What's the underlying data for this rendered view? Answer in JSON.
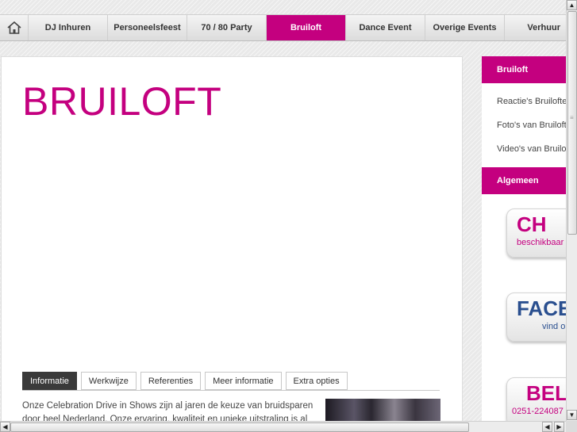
{
  "nav": {
    "home_icon": "home-icon",
    "items": [
      {
        "label": "DJ Inhuren",
        "active": false
      },
      {
        "label": "Personeelsfeest",
        "active": false
      },
      {
        "label": "70 / 80 Party",
        "active": false
      },
      {
        "label": "Bruiloft",
        "active": true
      },
      {
        "label": "Dance Event",
        "active": false
      },
      {
        "label": "Overige Events",
        "active": false
      },
      {
        "label": "Verhuur",
        "active": false
      }
    ]
  },
  "main": {
    "title": "BRUILOFT",
    "tabs": [
      {
        "label": "Informatie",
        "active": true
      },
      {
        "label": "Werkwijze",
        "active": false
      },
      {
        "label": "Referenties",
        "active": false
      },
      {
        "label": "Meer informatie",
        "active": false
      },
      {
        "label": "Extra opties",
        "active": false
      }
    ],
    "intro": "Onze Celebration Drive in Shows zijn al jaren de keuze van bruidsparen door heel Nederland. Onze ervaring, kwaliteit en unieke uitstraling is al"
  },
  "sidebar": {
    "section1_title": "Bruiloft",
    "links": [
      "Reactie's Bruiloften",
      "Foto's van Bruiloften",
      "Video's van Bruiloften"
    ],
    "section2_title": "Algemeen",
    "promos": [
      {
        "big": "CH",
        "small": "beschikbaar",
        "color": "#c4007f"
      },
      {
        "big": "FACE",
        "small": "vind o",
        "color": "#2a4f8f"
      },
      {
        "big": "BEL",
        "small": "0251-224087",
        "color": "#c4007f"
      }
    ]
  },
  "colors": {
    "accent": "#c4007f",
    "tab_active": "#3a3a3a"
  }
}
